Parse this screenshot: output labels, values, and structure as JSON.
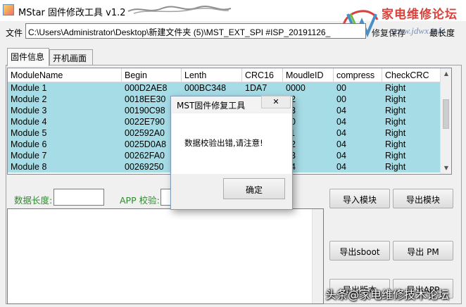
{
  "window": {
    "title": "MStar 固件修改工具 v1.2",
    "icon": "app-icon"
  },
  "watermark": {
    "brand": "家电维修论坛",
    "url": "www.jdwx.info",
    "footer": "头条@家电维修技术论坛",
    "brand_color": "#d9413b"
  },
  "file": {
    "label": "文件",
    "path": "C:\\Users\\Administrator\\Desktop\\新建文件夹 (5)\\MST_EXT_SPI #ISP_20191126_",
    "save_label": "修复保存",
    "max_label": "最长度"
  },
  "tabs": [
    {
      "label": "固件信息",
      "active": true
    },
    {
      "label": "开机画面",
      "active": false
    }
  ],
  "table": {
    "columns": [
      "ModuleName",
      "Begin",
      "Lenth",
      "CRC16",
      "MoudleID",
      "compress",
      "CheckCRC"
    ],
    "rows": [
      [
        "Module 1",
        "000D2AE8",
        "000BC348",
        "1DA7",
        "0000",
        "00",
        "Right"
      ],
      [
        "Module 2",
        "0018EE30",
        "",
        "",
        "02",
        "00",
        "Right"
      ],
      [
        "Module 3",
        "00190C98",
        "",
        "",
        "63",
        "04",
        "Right"
      ],
      [
        "Module 4",
        "0022E790",
        "",
        "",
        "10",
        "04",
        "Right"
      ],
      [
        "Module 5",
        "002592A0",
        "",
        "",
        "11",
        "04",
        "Right"
      ],
      [
        "Module 6",
        "0025D0A8",
        "",
        "",
        "12",
        "04",
        "Right"
      ],
      [
        "Module 7",
        "00262FA0",
        "",
        "",
        "13",
        "04",
        "Right"
      ],
      [
        "Module 8",
        "00269250",
        "",
        "",
        "14",
        "04",
        "Right"
      ]
    ],
    "selected_color": "#a6dce6"
  },
  "fields": {
    "data_length_label": "数据长度:",
    "app_check_label": "APP 校验:",
    "label_color": "#2f8a2f"
  },
  "buttons": {
    "import_module": "导入模块",
    "export_module": "导出模块",
    "export_sboot": "导出sboot",
    "export_pm": "导出 PM",
    "export_partial": "导出版本",
    "export_app": "导出APP"
  },
  "dialog": {
    "title": "MST固件修复工具",
    "message": "数据校验出错,请注意!",
    "ok_label": "确定",
    "close_glyph": "✕"
  }
}
